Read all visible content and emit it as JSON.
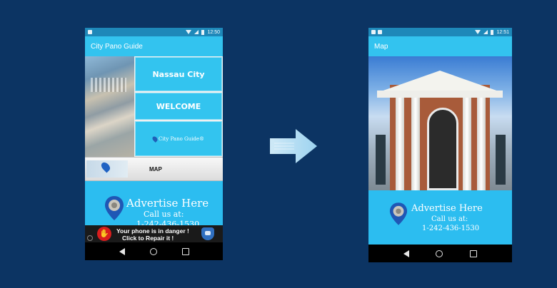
{
  "phone1": {
    "status_time": "12:50",
    "app_title": "City Pano Guide",
    "menu": {
      "nassau_label": "Nassau City",
      "welcome_label": "WELCOME",
      "logo_label": "City Pano Guide®",
      "map_label": "MAP"
    },
    "ad": {
      "title": "Advertise  Here",
      "call_us": "Call us at:",
      "phone_partial": "1-242-436-1530"
    },
    "banner": {
      "line1": "Your phone is in danger !",
      "line2": "Click to Repair it !"
    }
  },
  "phone2": {
    "status_time": "12:51",
    "app_title": "Map",
    "ad": {
      "title": "Advertise  Here",
      "call_us": "Call us at:",
      "phone": "1-242-436-1530"
    }
  },
  "colors": {
    "background": "#0c3463",
    "status_bar": "#1e88b9",
    "app_bar": "#33c3ef",
    "ad_background": "#2cbdf0"
  }
}
